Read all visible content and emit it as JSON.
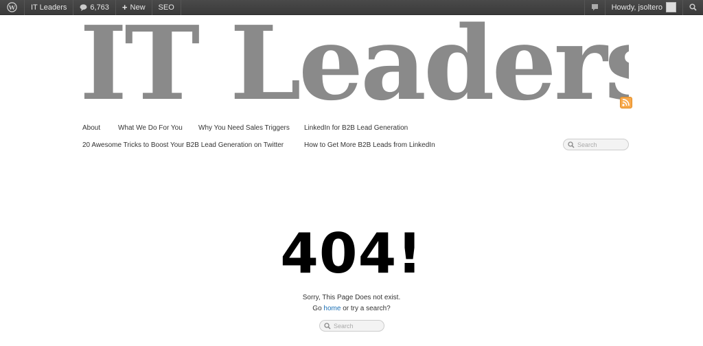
{
  "admin_bar": {
    "site_name": "IT Leaders",
    "comments_count": "6,763",
    "new_label": "New",
    "seo_label": "SEO",
    "greeting": "Howdy, jsoltero"
  },
  "header": {
    "site_title": "IT Leaders"
  },
  "nav": {
    "items": [
      "About",
      "What We Do For You",
      "Why You Need Sales Triggers",
      "LinkedIn for B2B Lead Generation",
      "20 Awesome Tricks to Boost Your B2B Lead Generation on Twitter",
      "How to Get More B2B Leads from LinkedIn"
    ]
  },
  "header_search": {
    "placeholder": "Search"
  },
  "error": {
    "code": "404!",
    "message": "Sorry, This Page Does not exist.",
    "go": "Go",
    "home_link": "home",
    "suffix": "or try a search?"
  },
  "error_search": {
    "placeholder": "Search"
  },
  "colors": {
    "admin_bar_bg": "#464646",
    "title_gray": "#8a8a8a",
    "link_blue": "#1a6fb5",
    "rss_orange": "#f7a84b"
  }
}
